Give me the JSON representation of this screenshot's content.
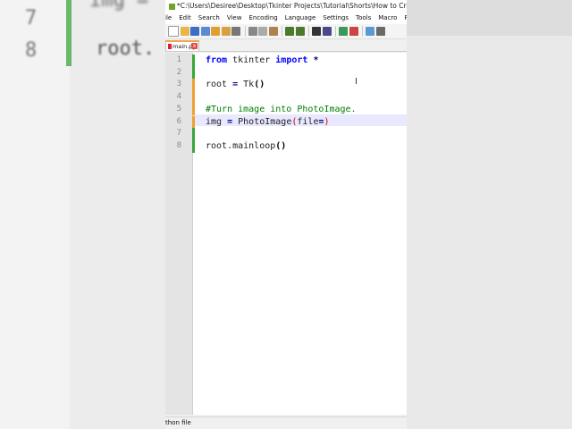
{
  "backdrop": {
    "left_line_numbers": [
      "7",
      "8"
    ],
    "left_code": "root.",
    "left_top_code": "img ="
  },
  "window": {
    "title": "*C:\\Users\\Desiree\\Desktop\\Tkinter Projects\\Tutorial\\Shorts\\How to Create an Im"
  },
  "menu": [
    "ile",
    "Edit",
    "Search",
    "View",
    "Encoding",
    "Language",
    "Settings",
    "Tools",
    "Macro",
    "R"
  ],
  "tab": {
    "label": "main.py",
    "close": "x"
  },
  "editor": {
    "lines": [
      {
        "num": "1",
        "tokens": [
          {
            "t": "from",
            "c": "kw"
          },
          {
            "t": " tkinter ",
            "c": ""
          },
          {
            "t": "import",
            "c": "kw"
          },
          {
            "t": " ",
            "c": ""
          },
          {
            "t": "*",
            "c": "op"
          }
        ]
      },
      {
        "num": "2",
        "tokens": []
      },
      {
        "num": "3",
        "tokens": [
          {
            "t": "root ",
            "c": ""
          },
          {
            "t": "=",
            "c": "op"
          },
          {
            "t": " Tk",
            "c": ""
          },
          {
            "t": "()",
            "c": "paren"
          }
        ]
      },
      {
        "num": "4",
        "tokens": []
      },
      {
        "num": "5",
        "tokens": [
          {
            "t": "#Turn image into PhotoImage.",
            "c": "comment"
          }
        ]
      },
      {
        "num": "6",
        "tokens": [
          {
            "t": "img ",
            "c": ""
          },
          {
            "t": "=",
            "c": "op"
          },
          {
            "t": " PhotoImage",
            "c": ""
          },
          {
            "t": "(",
            "c": "cursorbracket"
          },
          {
            "t": "file",
            "c": ""
          },
          {
            "t": "=",
            "c": "op"
          },
          {
            "t": ")",
            "c": "cursorbracket"
          }
        ]
      },
      {
        "num": "7",
        "tokens": []
      },
      {
        "num": "8",
        "tokens": [
          {
            "t": "root.mainloop",
            "c": ""
          },
          {
            "t": "()",
            "c": "paren"
          }
        ]
      }
    ],
    "change_marker_colors": [
      "#3aa63a",
      "#3aa63a",
      "#f0a030",
      "#f0a030",
      "#f0a030",
      "#f0a030",
      "#3aa63a",
      "#3aa63a"
    ],
    "current_line": 6
  },
  "status": {
    "text": "thon file"
  },
  "colors": {
    "accent_tab": "#f4a64a",
    "saved_marker": "#3aa63a",
    "unsaved_marker": "#f0a030"
  }
}
